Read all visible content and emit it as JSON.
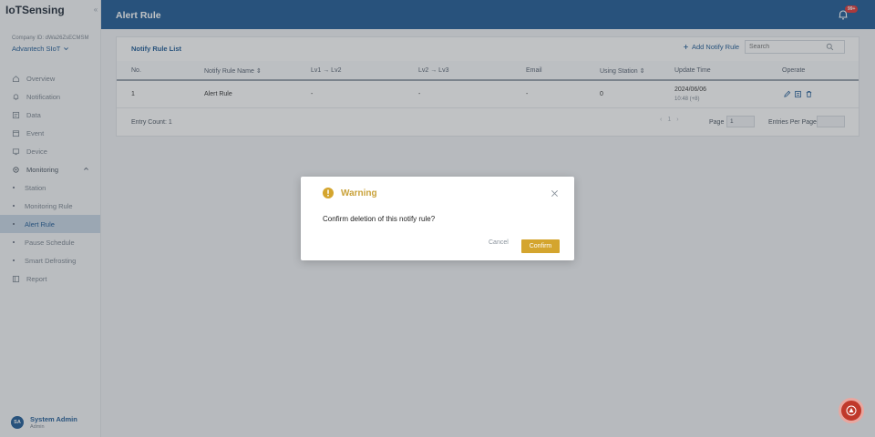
{
  "app": {
    "brand": "IoTSensing",
    "collapse_glyph": "«"
  },
  "company": {
    "id_label": "Company ID: dWa26ZsECMSM",
    "name": "Advantech SIoT"
  },
  "nav": {
    "items": [
      {
        "label": "Overview",
        "icon": "home-icon"
      },
      {
        "label": "Notification",
        "icon": "bell-icon"
      },
      {
        "label": "Data",
        "icon": "data-icon"
      },
      {
        "label": "Event",
        "icon": "event-icon"
      },
      {
        "label": "Device",
        "icon": "device-icon"
      },
      {
        "label": "Monitoring",
        "icon": "gear-icon"
      },
      {
        "label": "Station"
      },
      {
        "label": "Monitoring Rule"
      },
      {
        "label": "Alert Rule"
      },
      {
        "label": "Pause Schedule"
      },
      {
        "label": "Smart Defrosting"
      },
      {
        "label": "Report",
        "icon": "report-icon"
      }
    ],
    "active": "Alert Rule"
  },
  "user": {
    "initials": "SA",
    "name": "System Admin",
    "role": "Admin"
  },
  "header": {
    "title": "Alert Rule",
    "badge": "99+"
  },
  "card": {
    "title": "Notify Rule List",
    "add_label": "Add Notify Rule",
    "search_placeholder": "Search",
    "columns": [
      "No.",
      "Notify Rule Name",
      "Lv1 → Lv2",
      "Lv2 → Lv3",
      "Email",
      "Using Station",
      "Update Time",
      "Operate"
    ],
    "rows": [
      {
        "no": "1",
        "name": "Alert Rule",
        "lv12": "-",
        "lv23": "-",
        "email": "-",
        "stations": "0",
        "date": "2024/06/06",
        "time": "10:48 (+8)"
      }
    ],
    "entry_count": "Entry Count: 1",
    "pager": {
      "prev": "‹",
      "current": "1",
      "next": "›",
      "page_label": "Page",
      "page_value": "1",
      "per_page_label": "Entries Per Page"
    }
  },
  "modal": {
    "title": "Warning",
    "message": "Confirm deletion of this notify rule?",
    "cancel": "Cancel",
    "confirm": "Confirm",
    "accent": "#d4a52e"
  },
  "colors": {
    "primary": "#1f5b96",
    "danger": "#c0392b"
  }
}
